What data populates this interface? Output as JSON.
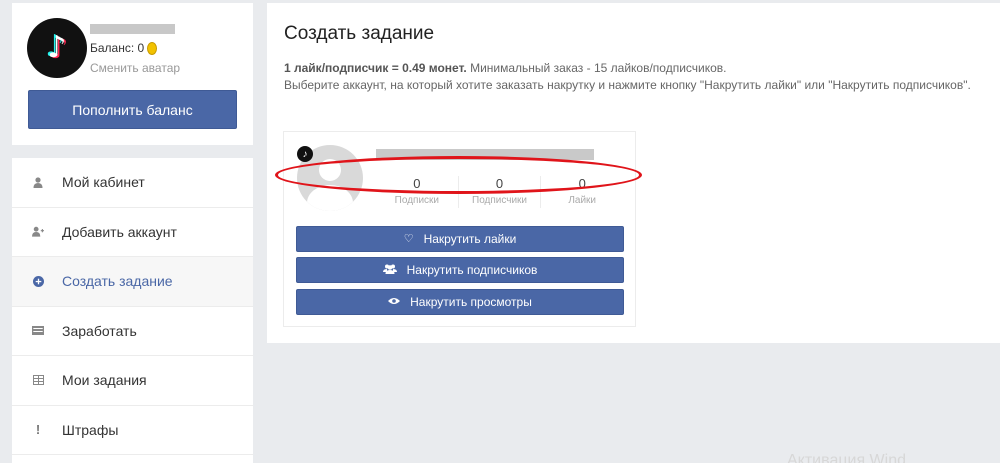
{
  "profile": {
    "balance_label": "Баланс: 0",
    "change_avatar": "Сменить аватар",
    "topup_button": "Пополнить баланс"
  },
  "menu": {
    "items": [
      {
        "label": "Мой кабинет",
        "icon": "user-icon"
      },
      {
        "label": "Добавить аккаунт",
        "icon": "user-plus-icon"
      },
      {
        "label": "Создать задание",
        "icon": "plus-circle-icon"
      },
      {
        "label": "Заработать",
        "icon": "money-icon"
      },
      {
        "label": "Мои задания",
        "icon": "grid-icon"
      },
      {
        "label": "Штрафы",
        "icon": "exclamation-icon"
      }
    ]
  },
  "main": {
    "title": "Создать задание",
    "desc_bold": "1 лайк/подписчик = 0.49 монет.",
    "desc_line1_rest": " Минимальный заказ - 15 лайков/подписчиков.",
    "desc_line2": "Выберите аккаунт, на который хотите заказать накрутку и нажмите кнопку \"Накрутить лайки\" или \"Накрутить подписчиков\"."
  },
  "account": {
    "stats": [
      {
        "value": "0",
        "label": "Подписки"
      },
      {
        "value": "0",
        "label": "Подписчики"
      },
      {
        "value": "0",
        "label": "Лайки"
      }
    ],
    "buttons": {
      "likes": "Накрутить лайки",
      "followers": "Накрутить подписчиков",
      "views": "Накрутить просмотры"
    }
  },
  "watermark": "Активация Wind"
}
